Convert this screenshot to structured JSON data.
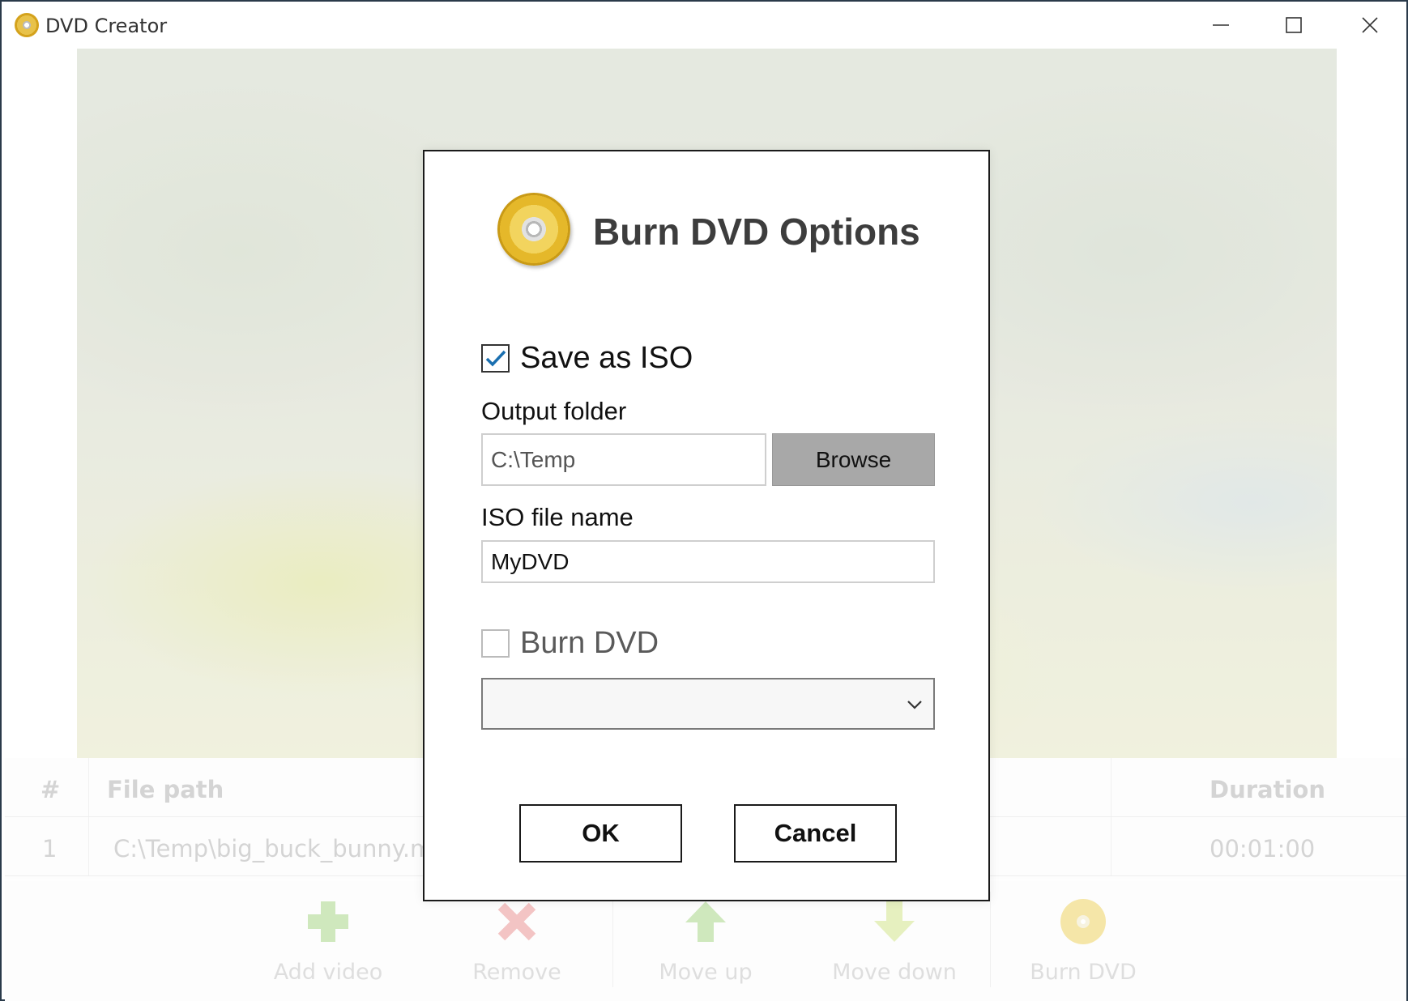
{
  "window": {
    "title": "DVD Creator",
    "controls": {
      "minimize": "—",
      "maximize": "☐",
      "close": "✕"
    }
  },
  "table": {
    "headers": {
      "index": "#",
      "file_path": "File path",
      "duration": "Duration"
    },
    "rows": [
      {
        "index": "1",
        "file_path": "C:\\Temp\\big_buck_bunny.m",
        "duration": "00:01:00"
      }
    ]
  },
  "toolbar": {
    "items": [
      {
        "label": "Add video",
        "icon": "plus-icon",
        "color": "#cfe8bd"
      },
      {
        "label": "Remove",
        "icon": "x-icon",
        "color": "#f3c4c4"
      },
      {
        "label": "Move up",
        "icon": "arrow-up-icon",
        "color": "#cfe8bd"
      },
      {
        "label": "Move down",
        "icon": "arrow-down-icon",
        "color": "#e6f0bf"
      },
      {
        "label": "Burn DVD",
        "icon": "disc-icon",
        "color": "#f5e6a8"
      }
    ]
  },
  "dialog": {
    "title": "Burn DVD Options",
    "save_iso": {
      "label": "Save as ISO",
      "checked": true
    },
    "output_folder": {
      "label": "Output folder",
      "value": "C:\\Temp"
    },
    "browse_label": "Browse",
    "iso_name": {
      "label": "ISO file name",
      "value": "MyDVD"
    },
    "burn_dvd": {
      "label": "Burn DVD",
      "checked": false
    },
    "drive_select": {
      "value": ""
    },
    "ok_label": "OK",
    "cancel_label": "Cancel"
  },
  "colors": {
    "accent": "#1a6fb0",
    "disabled_text": "#5a5a5a",
    "browse_bg": "#a8a8a8"
  }
}
